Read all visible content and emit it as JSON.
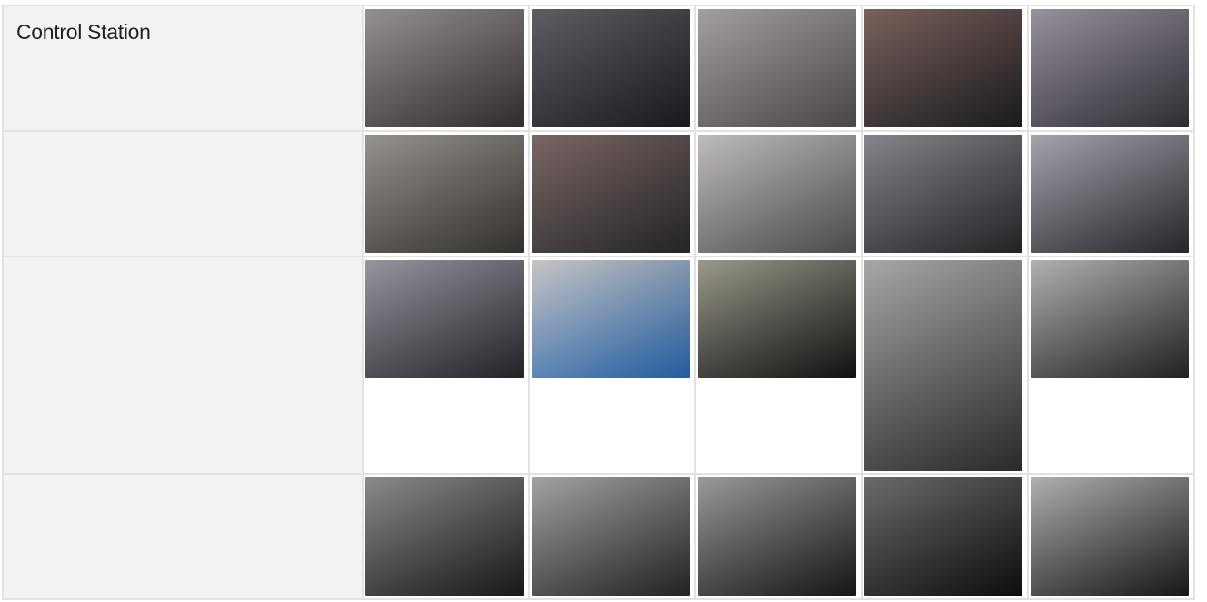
{
  "gallery": {
    "section_label": "Control Station",
    "rows": [
      [
        {
          "icon": "photo-icon",
          "color_a": "#8a8388",
          "color_b": "#3b3537",
          "tall": false
        },
        {
          "icon": "photo-icon",
          "color_a": "#4b4c52",
          "color_b": "#1e1f23",
          "tall": false
        },
        {
          "icon": "photo-icon",
          "color_a": "#9a9397",
          "color_b": "#5c5457",
          "tall": false
        },
        {
          "icon": "photo-icon",
          "color_a": "#6a4f4a",
          "color_b": "#202022",
          "tall": false
        },
        {
          "icon": "photo-icon",
          "color_a": "#8c8592",
          "color_b": "#3a3640",
          "tall": false
        }
      ],
      [
        {
          "icon": "photo-icon",
          "color_a": "#8c8680",
          "color_b": "#3d3a37",
          "tall": false
        },
        {
          "icon": "photo-icon",
          "color_a": "#6b5552",
          "color_b": "#2c2b2e",
          "tall": false
        },
        {
          "icon": "photo-icon",
          "color_a": "#b8b6b4",
          "color_b": "#5a5a5c",
          "tall": false
        },
        {
          "icon": "photo-icon",
          "color_a": "#7a7680",
          "color_b": "#2a2a2e",
          "tall": false
        },
        {
          "icon": "photo-icon",
          "color_a": "#9c99a6",
          "color_b": "#2f2e33",
          "tall": false
        }
      ],
      [
        {
          "icon": "photo-icon",
          "color_a": "#8a8a96",
          "color_b": "#2a2a30",
          "tall": false
        },
        {
          "icon": "photo-icon",
          "color_a": "#c0bfbd",
          "color_b": "#2a6fc0",
          "tall": false
        },
        {
          "icon": "photo-icon",
          "color_a": "#8e8e7e",
          "color_b": "#141414",
          "tall": false
        },
        {
          "icon": "photo-icon",
          "color_a": "#9e9d9b",
          "color_b": "#333334",
          "tall": true
        },
        {
          "icon": "photo-icon",
          "color_a": "#a9a9a9",
          "color_b": "#2a2826",
          "tall": false
        }
      ],
      [
        {
          "icon": "photo-icon",
          "color_a": "#7f7d7b",
          "color_b": "#1d1d1f",
          "tall": false
        },
        {
          "icon": "photo-icon",
          "color_a": "#9a9896",
          "color_b": "#2a2a2b",
          "tall": false
        },
        {
          "icon": "photo-icon",
          "color_a": "#8f8e8c",
          "color_b": "#1a1a1b",
          "tall": false
        },
        {
          "icon": "photo-icon",
          "color_a": "#5a5a5c",
          "color_b": "#101012",
          "tall": false
        },
        {
          "icon": "photo-icon",
          "color_a": "#a8a7a5",
          "color_b": "#1c1c1e",
          "tall": false
        }
      ]
    ]
  }
}
